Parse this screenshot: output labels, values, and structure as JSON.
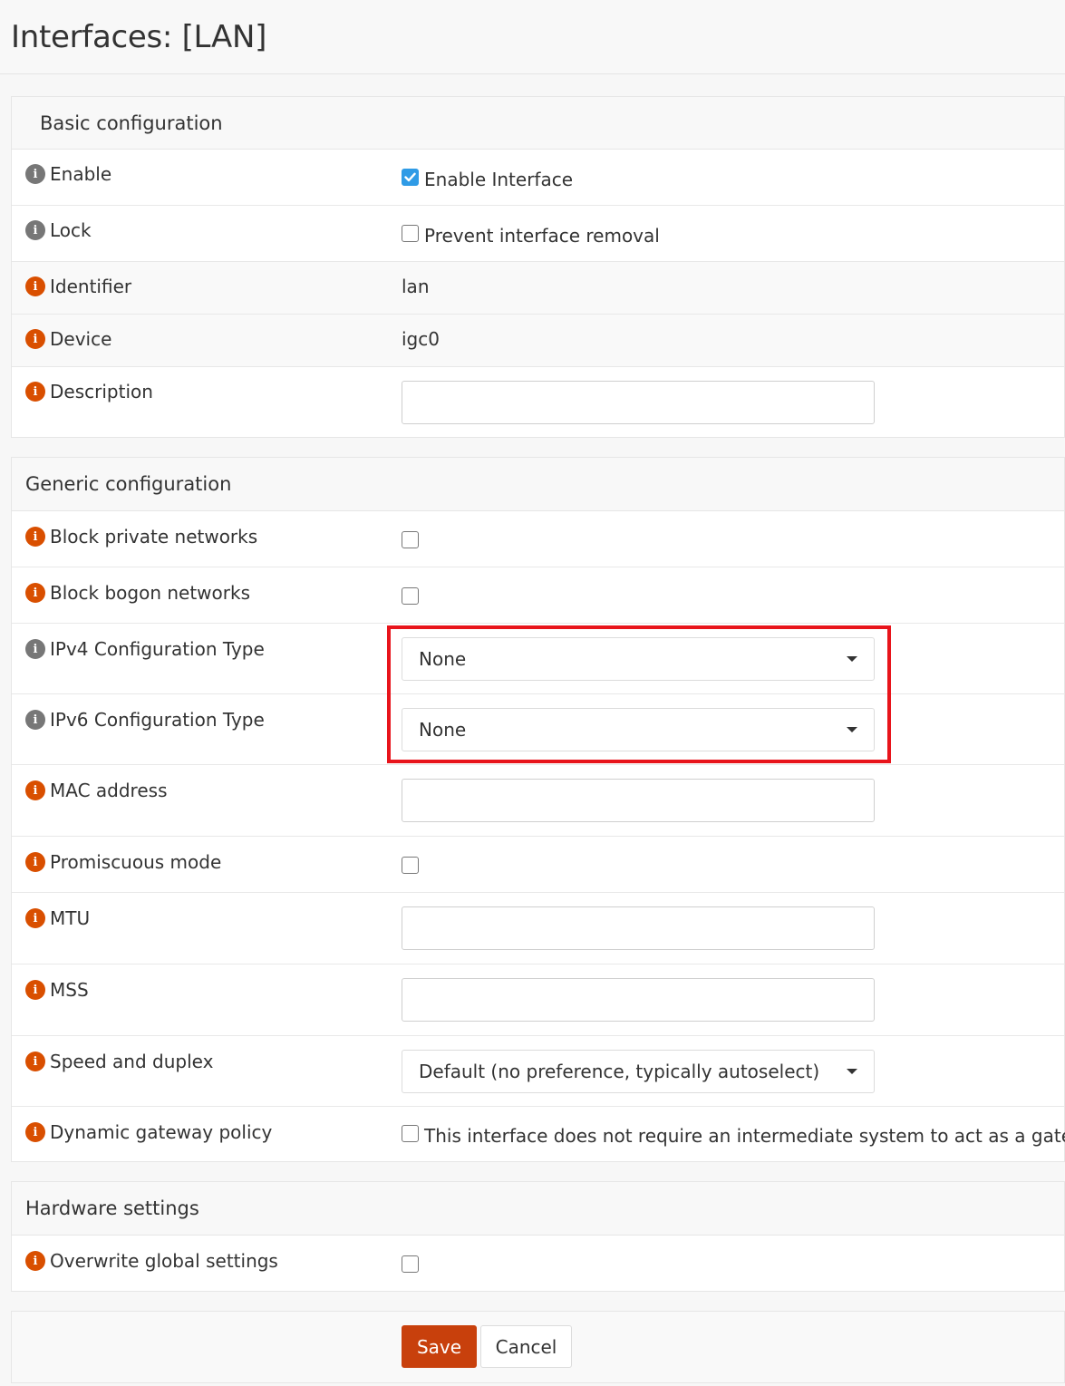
{
  "page": {
    "title": "Interfaces: [LAN]"
  },
  "basic": {
    "heading": "Basic configuration",
    "enable": {
      "label": "Enable",
      "option": "Enable Interface",
      "checked": true
    },
    "lock": {
      "label": "Lock",
      "option": "Prevent interface removal",
      "checked": false
    },
    "identifier": {
      "label": "Identifier",
      "value": "lan"
    },
    "device": {
      "label": "Device",
      "value": "igc0"
    },
    "description": {
      "label": "Description",
      "value": ""
    }
  },
  "generic": {
    "heading": "Generic configuration",
    "block_private": {
      "label": "Block private networks",
      "checked": false
    },
    "block_bogon": {
      "label": "Block bogon networks",
      "checked": false
    },
    "ipv4": {
      "label": "IPv4 Configuration Type",
      "selected": "None"
    },
    "ipv6": {
      "label": "IPv6 Configuration Type",
      "selected": "None"
    },
    "mac": {
      "label": "MAC address",
      "value": ""
    },
    "promisc": {
      "label": "Promiscuous mode",
      "checked": false
    },
    "mtu": {
      "label": "MTU",
      "value": ""
    },
    "mss": {
      "label": "MSS",
      "value": ""
    },
    "speed": {
      "label": "Speed and duplex",
      "selected": "Default (no preference, typically autoselect)"
    },
    "dyn_gw": {
      "label": "Dynamic gateway policy",
      "option": "This interface does not require an intermediate system to act as a gateway",
      "checked": false
    }
  },
  "hardware": {
    "heading": "Hardware settings",
    "overwrite": {
      "label": "Overwrite global settings",
      "checked": false
    }
  },
  "actions": {
    "save": "Save",
    "cancel": "Cancel"
  },
  "colors": {
    "accent": "#c8400c",
    "info_icon_red": "#d94f00",
    "info_icon_grey": "#777777",
    "checkbox_checked": "#2f9be6",
    "highlight": "#e8141b"
  }
}
